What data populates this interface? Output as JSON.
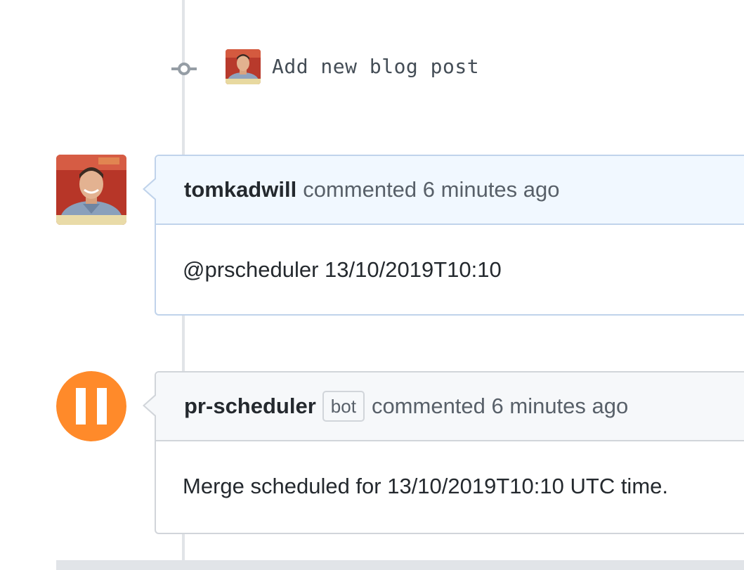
{
  "commit": {
    "message": "Add new blog post",
    "icon": "git-commit-icon"
  },
  "comments": [
    {
      "author": "tomkadwill",
      "action": "commented 6 minutes ago",
      "body": "@prscheduler 13/10/2019T10:10"
    },
    {
      "author": "pr-scheduler",
      "badge": "bot",
      "action": "commented 6 minutes ago",
      "body": "Merge scheduled for 13/10/2019T10:10 UTC time."
    }
  ],
  "colors": {
    "bot_avatar": "#ff8a2a",
    "user_header_bg": "#f1f8ff",
    "bot_header_bg": "#f6f8fa",
    "timeline": "#e1e4e8"
  }
}
